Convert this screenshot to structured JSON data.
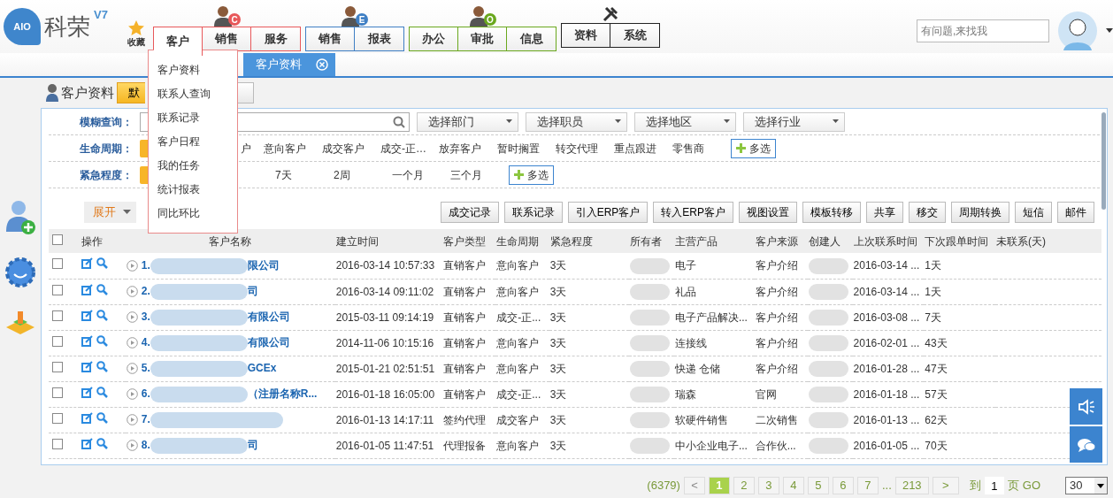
{
  "logo": {
    "badge": "AIO",
    "text": "科荣",
    "version": "V7"
  },
  "favorites": {
    "label": "收藏"
  },
  "nav_groups": [
    {
      "kind": "person",
      "badge": "C",
      "color": "#e8585a",
      "items": [
        {
          "label": "客户",
          "selected": true
        },
        {
          "label": "销售",
          "selected": false
        },
        {
          "label": "服务",
          "selected": false
        }
      ]
    },
    {
      "kind": "person",
      "badge": "E",
      "color": "#3f7fc4",
      "items": [
        {
          "label": "销售",
          "selected": false
        },
        {
          "label": "报表",
          "selected": false
        }
      ]
    },
    {
      "kind": "person",
      "badge": "O",
      "color": "#6aa81e",
      "items": [
        {
          "label": "办公",
          "selected": false
        },
        {
          "label": "审批",
          "selected": false
        },
        {
          "label": "信息",
          "selected": false
        }
      ]
    },
    {
      "kind": "tools",
      "color": "#222222",
      "items": [
        {
          "label": "资料",
          "selected": false
        },
        {
          "label": "系统",
          "selected": false
        }
      ]
    }
  ],
  "menu": {
    "items": [
      "客户资料",
      "联系人查询",
      "联系记录",
      "客户日程",
      "我的任务",
      "统计报表",
      "同比环比"
    ]
  },
  "search": {
    "placeholder": "有问题,来找我"
  },
  "tabs": [
    {
      "label": "客户资料",
      "selected": true
    }
  ],
  "page_title": "客户资料",
  "view_buttons": [
    {
      "label": "默",
      "selected": true
    },
    {
      "selected": false
    }
  ],
  "fuzzy_search": {
    "label": "模糊查询："
  },
  "selects": [
    "选择部门",
    "选择职员",
    "选择地区",
    "选择行业"
  ],
  "lifecycle": {
    "label": "生命周期：",
    "options": [
      {
        "selected": true
      },
      {
        "label": "户",
        "selected": false
      },
      {
        "label": "意向客户",
        "selected": false
      },
      {
        "label": "成交客户",
        "selected": false
      },
      {
        "label": "成交-正…",
        "selected": false
      },
      {
        "label": "放弃客户",
        "selected": false
      },
      {
        "label": "暂时搁置",
        "selected": false
      },
      {
        "label": "转交代理",
        "selected": false
      },
      {
        "label": "重点跟进",
        "selected": false
      },
      {
        "label": "零售商",
        "selected": false
      }
    ],
    "multi": "多选"
  },
  "urgency": {
    "label": "紧急程度：",
    "options": [
      {
        "selected": true
      },
      {
        "label": "7天",
        "selected": false
      },
      {
        "label": "2周",
        "selected": false
      },
      {
        "label": "一个月",
        "selected": false
      },
      {
        "label": "三个月",
        "selected": false
      }
    ],
    "multi": "多选"
  },
  "expand": {
    "label": "展开"
  },
  "actions": [
    "成交记录",
    "联系记录",
    "引入ERP客户",
    "转入ERP客户",
    "视图设置",
    "模板转移",
    "共享",
    "移交",
    "周期转换",
    "短信",
    "邮件"
  ],
  "table": {
    "header_checked": false,
    "columns": [
      "操作",
      "客户名称",
      "建立时间",
      "客户类型",
      "生命周期",
      "紧急程度",
      "所有者",
      "主营产品",
      "客户来源",
      "创建人",
      "上次联系时间",
      "下次跟单时间",
      "未联系(天)"
    ],
    "rows": [
      {
        "checked": false,
        "index": "1.",
        "name": "限公司",
        "created": "2016-03-14 10:57:33",
        "type": "直销客户",
        "lifecycle": "意向客户",
        "urgency": "3天",
        "product": "电子",
        "source": "客户介绍",
        "last_contact": "2016-03-14 ...",
        "next": "1天"
      },
      {
        "checked": false,
        "index": "2.",
        "name": "司",
        "created": "2016-03-14 09:11:02",
        "type": "直销客户",
        "lifecycle": "意向客户",
        "urgency": "3天",
        "product": "礼品",
        "source": "客户介绍",
        "last_contact": "2016-03-14 ...",
        "next": "1天"
      },
      {
        "checked": false,
        "index": "3.",
        "name": "有限公司",
        "created": "2015-03-11 09:14:19",
        "type": "直销客户",
        "lifecycle": "成交-正...",
        "urgency": "3天",
        "product": "电子产品解决...",
        "source": "客户介绍",
        "last_contact": "2016-03-08 ...",
        "next": "7天"
      },
      {
        "checked": false,
        "index": "4.",
        "name": "有限公司",
        "created": "2014-11-06 10:15:16",
        "type": "直销客户",
        "lifecycle": "意向客户",
        "urgency": "3天",
        "product": "连接线",
        "source": "客户介绍",
        "last_contact": "2016-02-01 ...",
        "next": "43天"
      },
      {
        "checked": false,
        "index": "5.",
        "name": "GCEx",
        "created": "2015-01-21 02:51:51",
        "type": "直销客户",
        "lifecycle": "意向客户",
        "urgency": "3天",
        "product": "快递 仓储",
        "source": "客户介绍",
        "last_contact": "2016-01-28 ...",
        "next": "47天"
      },
      {
        "checked": false,
        "index": "6.",
        "name": "（注册名称R...",
        "created": "2016-01-18 16:05:00",
        "type": "直销客户",
        "lifecycle": "成交-正...",
        "urgency": "3天",
        "product": "瑞森",
        "source": "官网",
        "last_contact": "2016-01-18 ...",
        "next": "57天"
      },
      {
        "checked": false,
        "index": "7.",
        "created": "2016-01-13 14:17:11",
        "type": "签约代理",
        "lifecycle": "成交客户",
        "urgency": "3天",
        "product": "软硬件销售",
        "source": "二次销售",
        "last_contact": "2016-01-13 ...",
        "next": "62天"
      },
      {
        "checked": false,
        "index": "8.",
        "name": "司",
        "created": "2016-01-05 11:47:51",
        "type": "代理报备",
        "lifecycle": "意向客户",
        "urgency": "3天",
        "product": "中小企业电子...",
        "source": "合作伙...",
        "last_contact": "2016-01-05 ...",
        "next": "70天"
      }
    ]
  },
  "pagination": {
    "total": "(6379)",
    "prev": "<",
    "pages": [
      {
        "label": "1",
        "selected": true
      },
      {
        "label": "2",
        "selected": false
      },
      {
        "label": "3",
        "selected": false
      },
      {
        "label": "4",
        "selected": false
      },
      {
        "label": "5",
        "selected": false
      },
      {
        "label": "6",
        "selected": false
      },
      {
        "label": "7",
        "selected": false
      }
    ],
    "ellipsis": "...",
    "last": "213",
    "next": ">",
    "goto": "到",
    "page_value": "1",
    "page_unit": "页",
    "go": "GO",
    "page_size": "30"
  }
}
